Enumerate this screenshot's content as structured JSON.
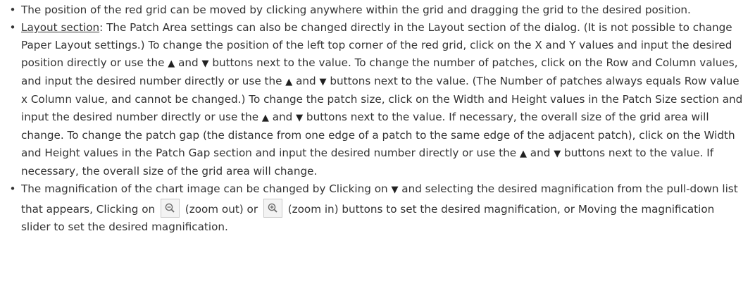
{
  "bullets": {
    "b1": {
      "text": "The position of the red grid can be moved by clicking anywhere within the grid and dragging the grid to the desired position."
    },
    "b2": {
      "heading": "Layout section",
      "t1": ": The Patch Area settings can also be changed directly in the Layout section of the dialog. (It is not possible to change Paper Layout settings.) To change the position of the left top corner of the red grid, click on the X and Y values and input the desired position directly or use the ",
      "t2": " and ",
      "t3": " buttons next to the value. To change the number of patches, click on the Row and Column values, and input the desired number directly or use the ",
      "t4": " and ",
      "t5": " buttons next to the value. (The Number of patches always equals Row value x Column value, and cannot be changed.) To change the patch size, click on the Width and Height values in the Patch Size section and input the desired number directly or use the ",
      "t6": " and ",
      "t7": " buttons next to the value. If necessary, the overall size of the grid area will change. To change the patch gap (the distance from one edge of a patch to the same edge of the adjacent patch), click on the Width and Height values in the Patch Gap section and input the desired number directly or use the ",
      "t8": " and ",
      "t9": " buttons next to the value. If necessary, the overall size of the grid area will change."
    },
    "b3": {
      "t1": "The magnification of the chart image can be changed by Clicking on ",
      "t2": " and selecting the desired magnification from the pull-down list that appears, Clicking on ",
      "t3": " (zoom out) or ",
      "t4": " (zoom in) buttons to set the desired magnification, or Moving the magnification slider to set the desired magnification."
    }
  },
  "glyphs": {
    "bullet": "•",
    "up": "▲",
    "down": "▼"
  },
  "icons": {
    "zoom_out": "zoom-out-icon",
    "zoom_in": "zoom-in-icon"
  }
}
